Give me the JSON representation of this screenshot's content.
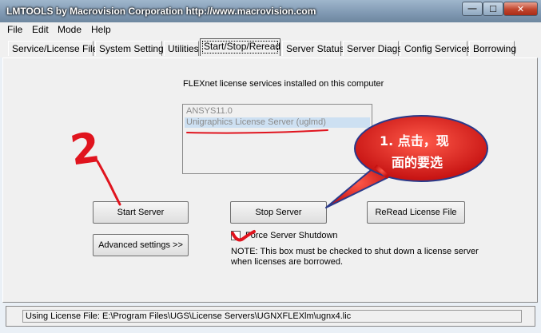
{
  "window": {
    "title": "LMTOOLS by Macrovision Corporation http://www.macrovision.com",
    "controls": {
      "minimize": "—",
      "maximize": "☐",
      "close": "✕"
    }
  },
  "menu": [
    "File",
    "Edit",
    "Mode",
    "Help"
  ],
  "tabs": [
    {
      "label": "Service/License File",
      "active": false
    },
    {
      "label": "System Settings",
      "active": false
    },
    {
      "label": "Utilities",
      "active": false
    },
    {
      "label": "Start/Stop/Reread",
      "active": true
    },
    {
      "label": "Server Status",
      "active": false
    },
    {
      "label": "Server Diags",
      "active": false
    },
    {
      "label": "Config Services",
      "active": false
    },
    {
      "label": "Borrowing",
      "active": false
    }
  ],
  "panel": {
    "services_heading": "FLEXnet license services installed on this computer",
    "services": [
      {
        "label": "ANSYS11.0",
        "selected": false
      },
      {
        "label": "Unigraphics License Server (uglmd)",
        "selected": true
      }
    ],
    "buttons": {
      "start": "Start Server",
      "stop": "Stop Server",
      "reread": "ReRead License File",
      "advanced": "Advanced settings >>"
    },
    "force_shutdown": {
      "label": "Force Server Shutdown",
      "checked": false
    },
    "note_line1": "NOTE:  This box must be checked to shut down a license server",
    "note_line2": "when licenses are borrowed."
  },
  "status": {
    "text": "Using License File:  E:\\Program Files\\UGS\\License Servers\\UGNXFLEXlm\\ugnx4.lic"
  },
  "annotations": {
    "step_number": "2",
    "callout_line1": "1. 点击，现",
    "callout_line2": "面的要选"
  },
  "colors": {
    "annotation_red": "#e0141e",
    "callout_fill": "#d61a1a",
    "selection": "#cde0f2",
    "disabled_text": "#8a8a8a"
  }
}
